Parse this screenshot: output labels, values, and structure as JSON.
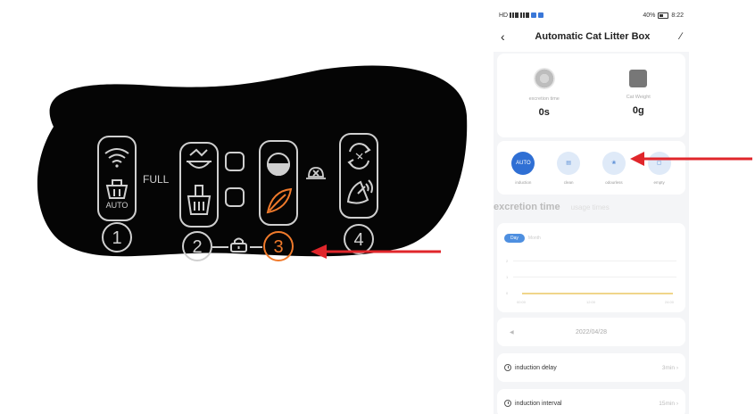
{
  "panel": {
    "full_label": "FULL",
    "auto_label": "AUTO",
    "buttons": [
      "1",
      "2",
      "3",
      "4"
    ]
  },
  "phone": {
    "status": {
      "left": "HD",
      "right": "40%",
      "time": "8:22"
    },
    "nav": {
      "back_icon": "chevron-left-icon",
      "title": "Automatic Cat Litter Box",
      "edit_icon": "pencil-icon"
    },
    "stats": [
      {
        "label": "excretion time",
        "value": "0s"
      },
      {
        "label": "Cat Weight",
        "value": "0g"
      }
    ],
    "modes": [
      {
        "icon_text": "AUTO",
        "label": "induction",
        "active": true
      },
      {
        "icon_text": "",
        "label": "clean",
        "active": false
      },
      {
        "icon_text": "",
        "label": "odourless",
        "active": false
      },
      {
        "icon_text": "",
        "label": "empty",
        "active": false
      }
    ],
    "tabs": {
      "main": "excretion time",
      "sub": "usage times"
    },
    "chart_toggle": {
      "on": "Day",
      "off": "Month"
    },
    "chart_y": [
      "2",
      "1",
      "0"
    ],
    "chart_x": [
      "00:00",
      "12:00",
      "24:00"
    ],
    "date": "2022/04/28",
    "settings": [
      {
        "label": "induction delay",
        "value": "3min"
      },
      {
        "label": "induction interval",
        "value": "15min"
      }
    ]
  },
  "colors": {
    "accent": "#2f6fd4",
    "arrow": "#e0262b",
    "orange": "#f07a2b",
    "panel_bg": "#050505",
    "panel_line": "#cfcfcf"
  }
}
